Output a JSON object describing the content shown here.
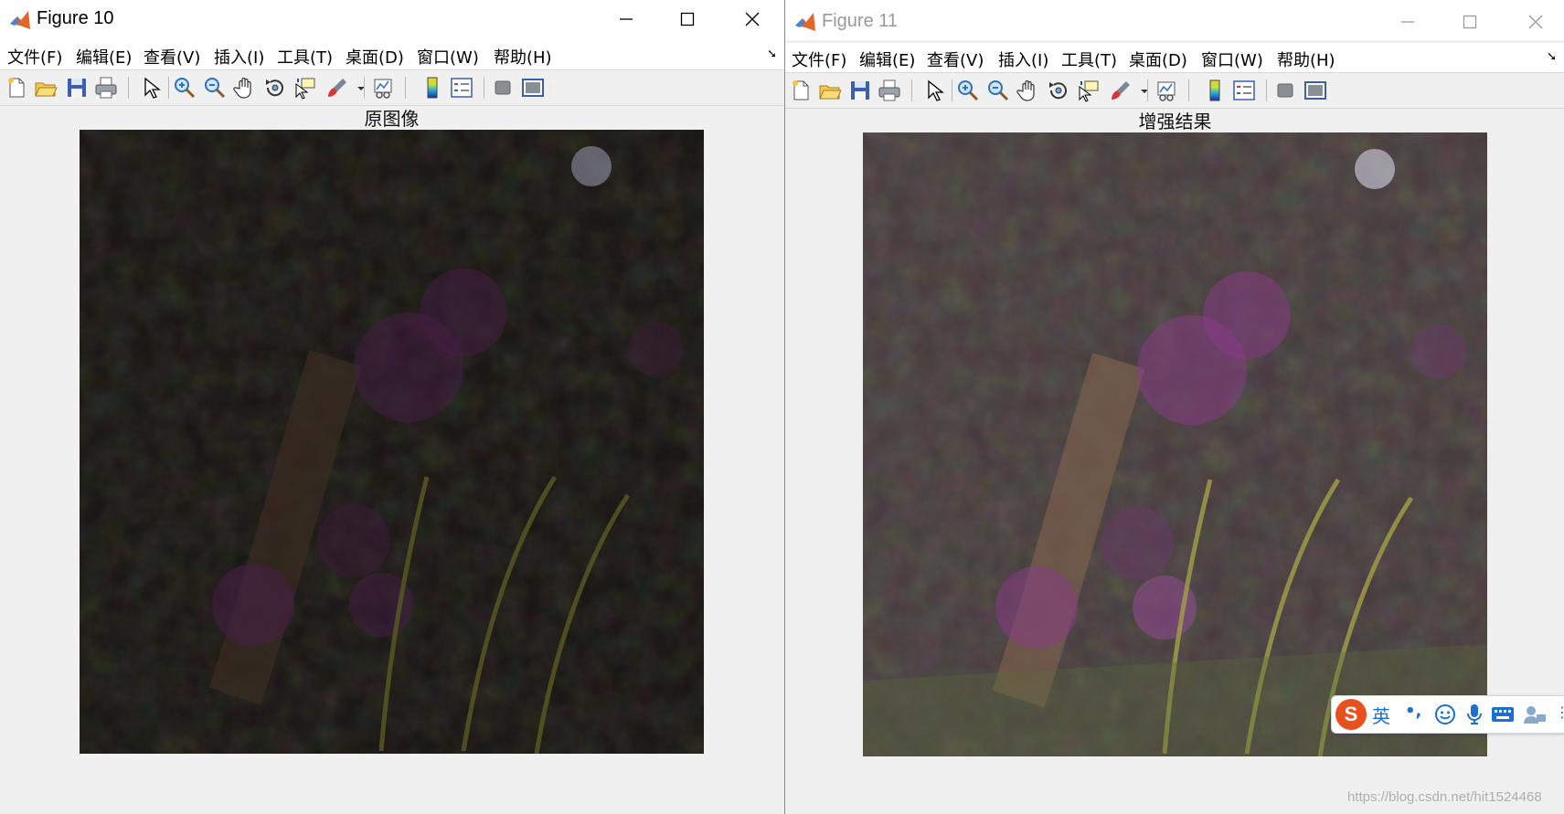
{
  "windows": [
    {
      "title": "Figure 10",
      "menu": [
        "文件(F)",
        "编辑(E)",
        "查看(V)",
        "插入(I)",
        "工具(T)",
        "桌面(D)",
        "窗口(W)",
        "帮助(H)"
      ],
      "axes_title": "原图像"
    },
    {
      "title": "Figure 11",
      "menu": [
        "文件(F)",
        "编辑(E)",
        "查看(V)",
        "插入(I)",
        "工具(T)",
        "桌面(D)",
        "窗口(W)",
        "帮助(H)"
      ],
      "axes_title": "增强结果"
    }
  ],
  "toolbar_icons": [
    "new-figure-icon",
    "open-file-icon",
    "save-icon",
    "print-icon",
    "select-pointer-icon",
    "zoom-in-icon",
    "zoom-out-icon",
    "pan-hand-icon",
    "rotate-3d-icon",
    "data-cursor-icon",
    "brush-icon",
    "link-plot-icon",
    "colorbar-icon",
    "legend-icon",
    "hide-plot-tools-icon",
    "show-plot-tools-icon"
  ],
  "ime": {
    "language": "英",
    "punct": "•,"
  },
  "watermark": "https://blog.csdn.net/hit1524468",
  "colors": {
    "titlebar": "#ffffff",
    "window_bg": "#f0f0f0",
    "ime_accent": "#e8501e",
    "ime_blue": "#1a6fd0"
  }
}
